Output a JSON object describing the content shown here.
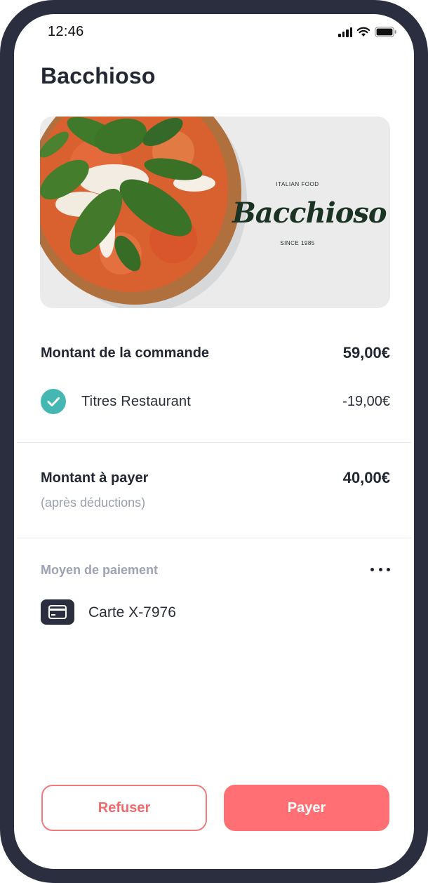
{
  "status_bar": {
    "time": "12:46"
  },
  "app": {
    "title": "Bacchioso"
  },
  "hero": {
    "brand_top": "ITALIAN FOOD",
    "brand_name": "Bacchioso",
    "brand_bottom": "SINCE 1985"
  },
  "order": {
    "label": "Montant de la commande",
    "amount": "59,00€",
    "voucher_label": "Titres Restaurant",
    "voucher_amount": "-19,00€"
  },
  "total": {
    "label": "Montant à payer",
    "note": "(après déductions)",
    "amount": "40,00€"
  },
  "payment": {
    "title": "Moyen de paiement",
    "method": "Carte X-7976"
  },
  "actions": {
    "refuse": "Refuser",
    "pay": "Payer"
  },
  "colors": {
    "accent": "#ff6f73",
    "check": "#45b7b3",
    "frame": "#2b2e3f"
  }
}
